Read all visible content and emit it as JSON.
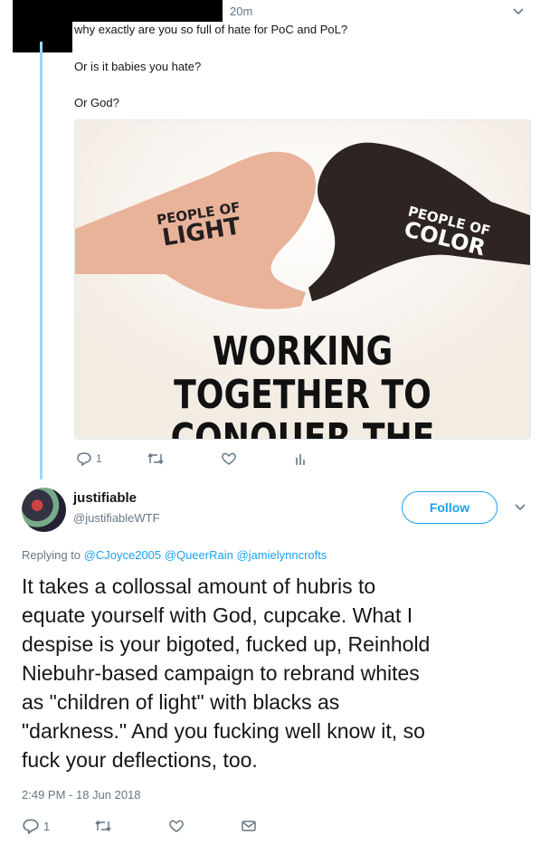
{
  "quoted_tweet": {
    "timestamp": "20m",
    "line1": "why exactly are you so full of hate for PoC and PoL?",
    "line2": "Or is it babies you hate?",
    "line3": "Or God?",
    "media": {
      "label_left_1": "PEOPLE OF",
      "label_left_2": "LIGHT",
      "label_right_1": "PEOPLE OF",
      "label_right_2": "COLOR",
      "headline_1": "WORKING TOGETHER TO",
      "headline_2": "CONQUER THE STARS"
    },
    "actions": {
      "reply_count": "1"
    }
  },
  "main_tweet": {
    "display_name": "justifiable",
    "handle": "@justifiableWTF",
    "follow_label": "Follow",
    "replying_prefix": "Replying to",
    "replying_to": [
      "@CJoyce2005",
      "@QueerRain",
      "@jamielynncrofts"
    ],
    "text": "It takes a collossal amount of hubris to\nequate yourself with God, cupcake. What I\ndespise is your bigoted, fucked up, Reinhold\nNiebuhr-based campaign to rebrand whites\nas \"children of light\" with blacks as\n\"darkness.\" And you fucking well know it, so\nfuck your deflections, too.",
    "timestamp": "2:49 PM - 18 Jun 2018",
    "actions": {
      "reply_count": "1"
    }
  },
  "colors": {
    "accent": "#1da1f2",
    "thread_line": "#9fd7f5",
    "muted": "#657786"
  },
  "icons": [
    "reply-icon",
    "retweet-icon",
    "like-icon",
    "analytics-icon",
    "message-icon",
    "chevron-down-icon"
  ]
}
